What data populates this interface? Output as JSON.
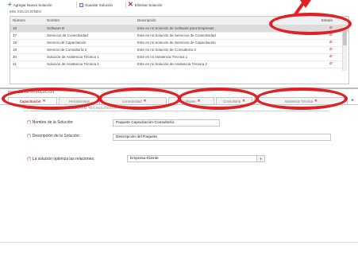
{
  "toolbar": {
    "add_label": "Agregar Nueva Solución",
    "save_label": "Guardar Solución",
    "delete_label": "Eliminar Solución"
  },
  "solutions_section": {
    "title": "MIS SOLUCIONES",
    "columns": [
      "Número",
      "Nombre",
      "Descripción",
      "Estado"
    ],
    "rows": [
      {
        "number": "16",
        "name": "Software B",
        "description": "Este es mi Solución de Software para Empresas",
        "selected": true
      },
      {
        "number": "17",
        "name": "Servicios de Conectividad",
        "description": "Este es mi Solución de Servicios de Conectividad",
        "selected": false
      },
      {
        "number": "18",
        "name": "Servicio de Capacitación",
        "description": "Este es mi Solución de Servicios de Capacitación",
        "selected": false
      },
      {
        "number": "19",
        "name": "Servicio de Consultoría 2",
        "description": "Este es mi Solución de Consultoría 2",
        "selected": false
      },
      {
        "number": "20",
        "name": "Solución de Asistencia Técnica 1",
        "description": "Este es mi Asistencia Técnica 1",
        "selected": false
      },
      {
        "number": "21",
        "name": "Solución de Asistencia Técnica 2",
        "description": "Este es mi Solución de Asistencia Técnica 2",
        "selected": false
      }
    ]
  },
  "detail_panel": {
    "title": "DETALLE DE LA SOLUCIÓN",
    "tabs": [
      {
        "label": "Capacitación",
        "active": true
      },
      {
        "label": "Herramientas",
        "active": false
      },
      {
        "label": "Conectividad",
        "active": false
      },
      {
        "label": "Software",
        "active": false
      },
      {
        "label": "Consultoría",
        "active": false
      },
      {
        "label": "Asistencia Técnica",
        "active": false
      }
    ]
  },
  "form": {
    "title": "DESCRIPCIÓN DE LA SOLUCIÓN TECNOLÓGICA",
    "required_mark": "(*)",
    "name_label": "Nombre de la Solución:",
    "name_value": "Paquete Capacitación-Consultoría",
    "description_label": "Descripción de la Solución:",
    "description_value": "Descripción del Paquete",
    "optimizes_label": "La solución optimiza las relaciones:",
    "optimizes_value": "Empresa-Cliente"
  },
  "colors": {
    "highlight": "#e02024",
    "required": "#d32f2f",
    "add_icon": "#2e9a2e",
    "delete_icon": "#d02020"
  },
  "icons": [
    "plus-icon",
    "save-icon",
    "delete-icon",
    "remove-row-icon",
    "close-tab-icon",
    "dropdown-arrow-icon",
    "tab-scroll-arrow-icon"
  ]
}
